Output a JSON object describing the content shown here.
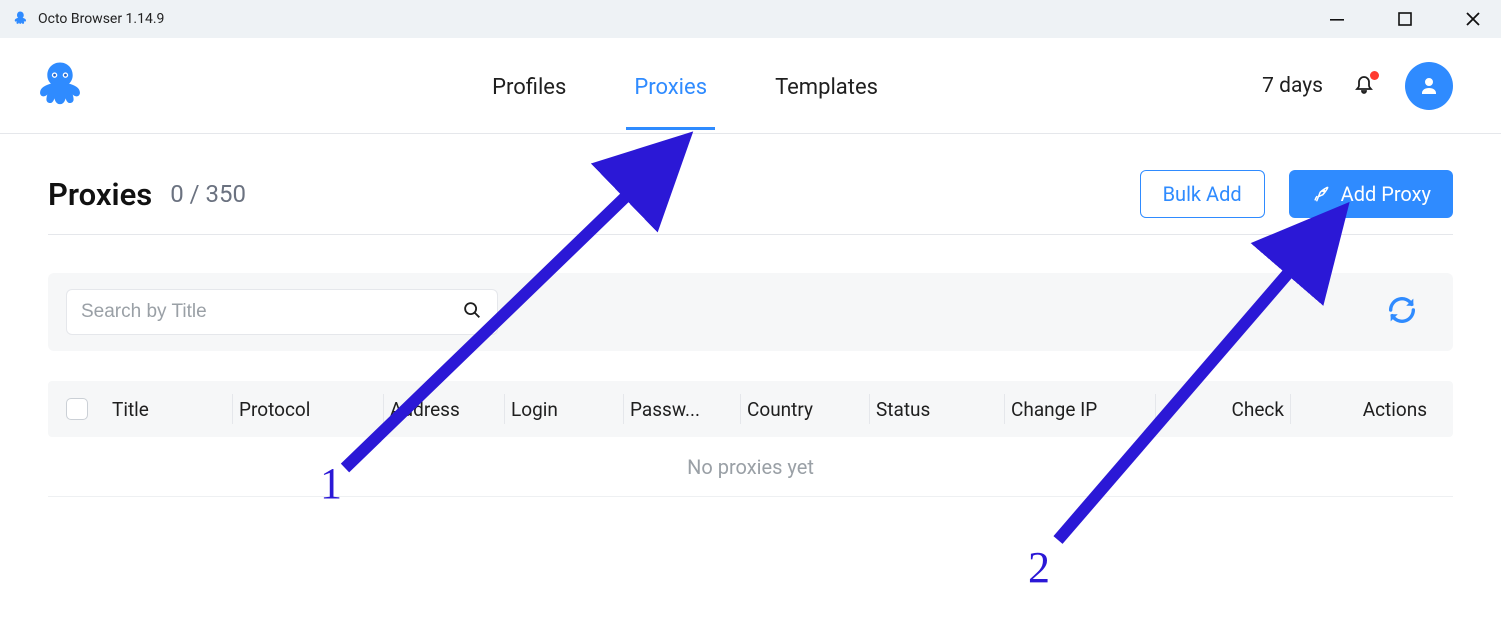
{
  "window": {
    "title": "Octo Browser 1.14.9"
  },
  "nav": {
    "items": [
      {
        "label": "Profiles",
        "active": false
      },
      {
        "label": "Proxies",
        "active": true
      },
      {
        "label": "Templates",
        "active": false
      }
    ],
    "days": "7 days"
  },
  "page": {
    "title": "Proxies",
    "count": "0 / 350",
    "bulkAdd": "Bulk Add",
    "addProxy": "Add Proxy"
  },
  "search": {
    "placeholder": "Search by Title"
  },
  "table": {
    "headers": {
      "title": "Title",
      "protocol": "Protocol",
      "address": "Address",
      "login": "Login",
      "password": "Passw...",
      "country": "Country",
      "status": "Status",
      "changeIp": "Change IP",
      "check": "Check",
      "actions": "Actions"
    },
    "empty": "No proxies yet"
  },
  "annotations": {
    "one": "1",
    "two": "2"
  }
}
